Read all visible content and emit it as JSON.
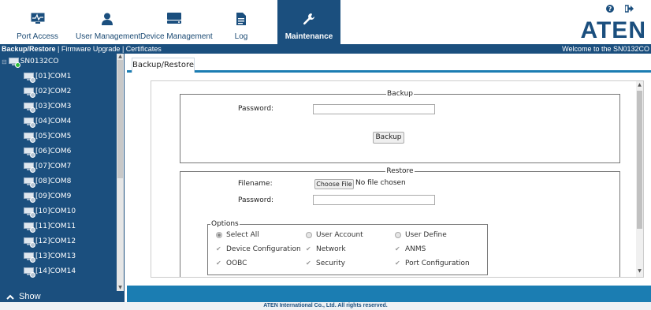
{
  "nav": {
    "items": [
      {
        "label": "Port Access",
        "icon": "port-access-icon"
      },
      {
        "label": "User Management",
        "icon": "user-icon"
      },
      {
        "label": "Device Management",
        "icon": "device-icon"
      },
      {
        "label": "Log",
        "icon": "log-icon"
      },
      {
        "label": "Maintenance",
        "icon": "wrench-icon",
        "active": true
      }
    ],
    "help_icon": "help-icon",
    "logout_icon": "logout-icon",
    "logo": "ATEN"
  },
  "subnav": {
    "backup_restore": "Backup/Restore",
    "firmware_upgrade": "Firmware Upgrade",
    "certificates": "Certificates",
    "welcome": "Welcome to the SN0132CO"
  },
  "tree": {
    "root": "SN0132CO",
    "ports": [
      "[01]COM1",
      "[02]COM2",
      "[03]COM3",
      "[04]COM4",
      "[05]COM5",
      "[06]COM6",
      "[07]COM7",
      "[08]COM8",
      "[09]COM9",
      "[10]COM10",
      "[11]COM11",
      "[12]COM12",
      "[13]COM13",
      "[14]COM14"
    ]
  },
  "sidebar": {
    "show_label": "Show"
  },
  "main": {
    "tab": "Backup/Restore",
    "backup": {
      "legend": "Backup",
      "password_label": "Password:",
      "password_value": "",
      "button": "Backup"
    },
    "restore": {
      "legend": "Restore",
      "filename_label": "Filename:",
      "choose_file": "Choose File",
      "no_file": "No file chosen",
      "password_label": "Password:",
      "password_value": ""
    },
    "options": {
      "legend": "Options",
      "select_all": "Select All",
      "user_account": "User Account",
      "user_define": "User Define",
      "device_configuration": "Device Configuration",
      "network": "Network",
      "anms": "ANMS",
      "oobc": "OOBC",
      "security": "Security",
      "port_configuration": "Port Configuration"
    }
  },
  "footer": "ATEN International Co., Ltd. All rights reserved.",
  "colors": {
    "brand": "#1b4f7e",
    "accent": "#1b7db2"
  }
}
